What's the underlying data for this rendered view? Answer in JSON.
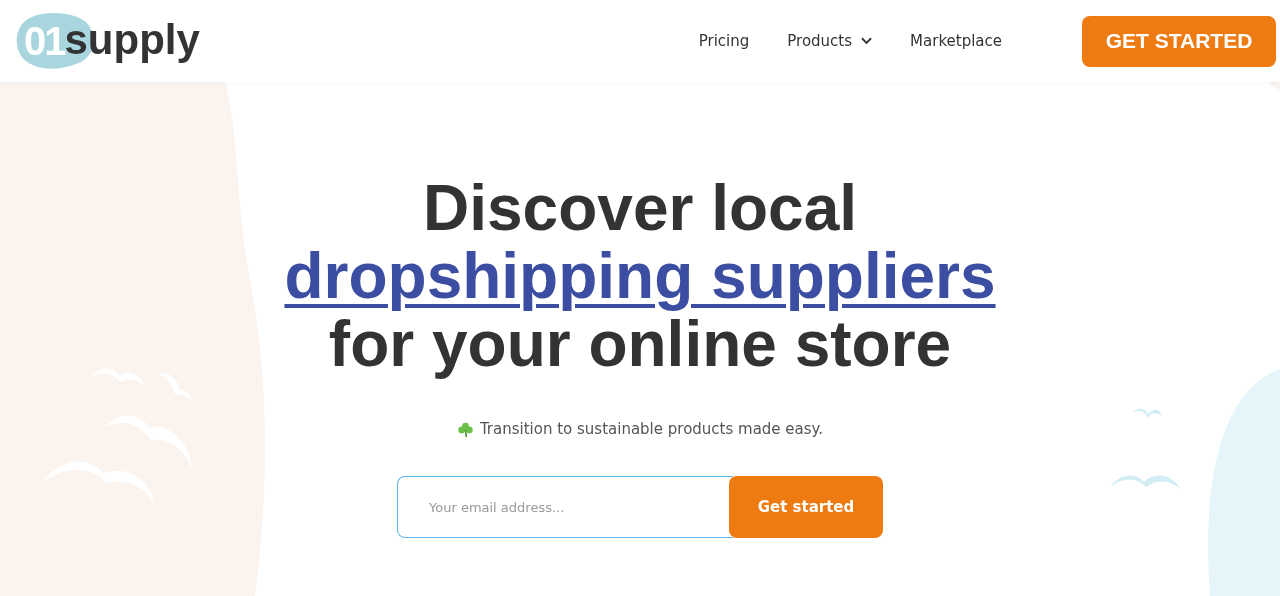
{
  "logo": {
    "digits": "01",
    "word": "supply"
  },
  "nav": [
    {
      "label": "Pricing",
      "dropdown": false
    },
    {
      "label": "Products",
      "dropdown": true
    },
    {
      "label": "Marketplace",
      "dropdown": false
    }
  ],
  "header_button": "GET STARTED",
  "hero": {
    "line_1": "Discover local",
    "link": "dropshipping suppliers",
    "line_3": "for your online store",
    "tagline": "Transition to sustainable products made easy.",
    "email": {
      "placeholder": "Your email address..."
    },
    "button": "Get started"
  }
}
